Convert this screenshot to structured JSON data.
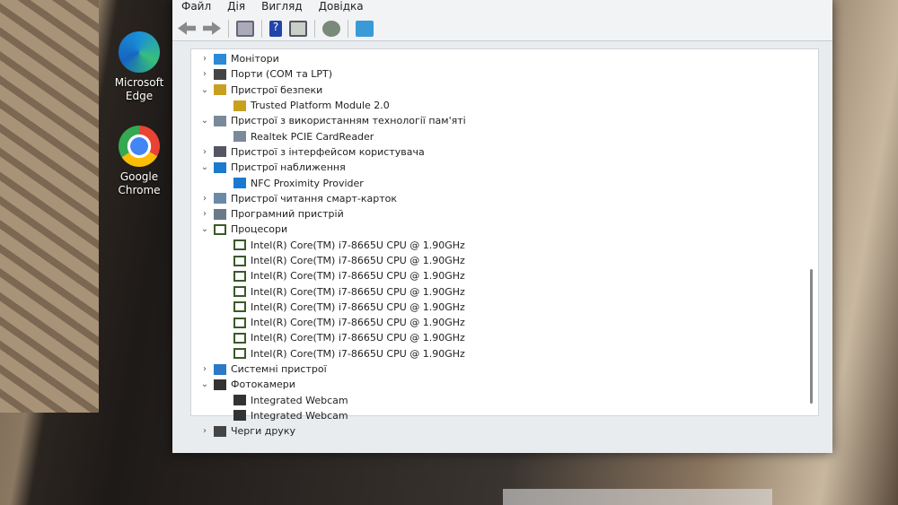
{
  "desktop": {
    "icons": [
      {
        "label": "Microsoft Edge"
      },
      {
        "label": "Google Chrome"
      }
    ]
  },
  "menu": [
    "Файл",
    "Дія",
    "Вигляд",
    "Довідка"
  ],
  "toolbar": [
    "back-icon",
    "forward-icon",
    "console-tree-icon",
    "help-icon",
    "properties-icon",
    "update-driver-icon",
    "scan-hardware-icon"
  ],
  "tree": [
    {
      "label": "Монітори",
      "level": 0,
      "expander": ">",
      "icon": "monitor",
      "color": "#2a8ad8"
    },
    {
      "label": "Порти (COM та LPT)",
      "level": 0,
      "expander": ">",
      "icon": "port",
      "color": "#444"
    },
    {
      "label": "Пристрої безпеки",
      "level": 0,
      "expander": "v",
      "icon": "security",
      "color": "#c8a020"
    },
    {
      "label": "Trusted Platform Module 2.0",
      "level": 1,
      "expander": "",
      "icon": "security",
      "color": "#c8a020"
    },
    {
      "label": "Пристрої з використанням технології пам'яті",
      "level": 0,
      "expander": "v",
      "icon": "memory",
      "color": "#7a8a9a"
    },
    {
      "label": "Realtek PCIE CardReader",
      "level": 1,
      "expander": "",
      "icon": "memory",
      "color": "#7a8a9a"
    },
    {
      "label": "Пристрої з інтерфейсом користувача",
      "level": 0,
      "expander": ">",
      "icon": "hid",
      "color": "#556"
    },
    {
      "label": "Пристрої наближення",
      "level": 0,
      "expander": "v",
      "icon": "proximity",
      "color": "#1a7ad0"
    },
    {
      "label": "NFC Proximity Provider",
      "level": 1,
      "expander": "",
      "icon": "proximity",
      "color": "#1a7ad0"
    },
    {
      "label": "Пристрої читання смарт-карток",
      "level": 0,
      "expander": ">",
      "icon": "smartcard",
      "color": "#6a8aa8"
    },
    {
      "label": "Програмний пристрій",
      "level": 0,
      "expander": ">",
      "icon": "software",
      "color": "#6a7a88"
    },
    {
      "label": "Процесори",
      "level": 0,
      "expander": "v",
      "icon": "cpu",
      "color": "#3a5a2a"
    },
    {
      "label": "Intel(R) Core(TM) i7-8665U CPU @ 1.90GHz",
      "level": 1,
      "expander": "",
      "icon": "cpu",
      "color": "#3a5a2a"
    },
    {
      "label": "Intel(R) Core(TM) i7-8665U CPU @ 1.90GHz",
      "level": 1,
      "expander": "",
      "icon": "cpu",
      "color": "#3a5a2a"
    },
    {
      "label": "Intel(R) Core(TM) i7-8665U CPU @ 1.90GHz",
      "level": 1,
      "expander": "",
      "icon": "cpu",
      "color": "#3a5a2a"
    },
    {
      "label": "Intel(R) Core(TM) i7-8665U CPU @ 1.90GHz",
      "level": 1,
      "expander": "",
      "icon": "cpu",
      "color": "#3a5a2a"
    },
    {
      "label": "Intel(R) Core(TM) i7-8665U CPU @ 1.90GHz",
      "level": 1,
      "expander": "",
      "icon": "cpu",
      "color": "#3a5a2a"
    },
    {
      "label": "Intel(R) Core(TM) i7-8665U CPU @ 1.90GHz",
      "level": 1,
      "expander": "",
      "icon": "cpu",
      "color": "#3a5a2a"
    },
    {
      "label": "Intel(R) Core(TM) i7-8665U CPU @ 1.90GHz",
      "level": 1,
      "expander": "",
      "icon": "cpu",
      "color": "#3a5a2a"
    },
    {
      "label": "Intel(R) Core(TM) i7-8665U CPU @ 1.90GHz",
      "level": 1,
      "expander": "",
      "icon": "cpu",
      "color": "#3a5a2a"
    },
    {
      "label": "Системні пристрої",
      "level": 0,
      "expander": ">",
      "icon": "system",
      "color": "#2a7ac8"
    },
    {
      "label": "Фотокамери",
      "level": 0,
      "expander": "v",
      "icon": "camera",
      "color": "#333"
    },
    {
      "label": "Integrated Webcam",
      "level": 1,
      "expander": "",
      "icon": "camera",
      "color": "#333"
    },
    {
      "label": "Integrated Webcam",
      "level": 1,
      "expander": "",
      "icon": "camera",
      "color": "#333"
    },
    {
      "label": "Черги друку",
      "level": 0,
      "expander": ">",
      "icon": "printer",
      "color": "#444"
    }
  ]
}
